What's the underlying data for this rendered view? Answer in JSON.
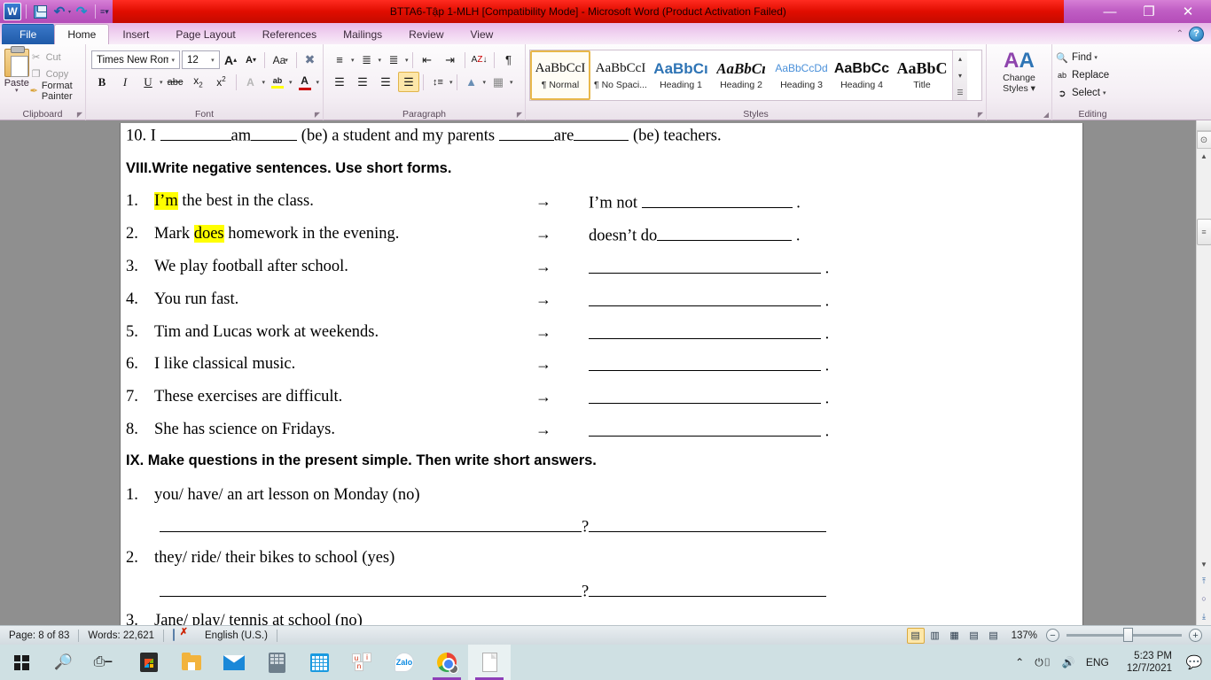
{
  "titlebar": {
    "document_title": "BTTA6-Tập 1-MLH [Compatibility Mode]  -  Microsoft Word (Product Activation Failed)",
    "qat": {
      "word_logo": "W",
      "save": "save-icon",
      "undo": "↺",
      "undo_caret": "▾",
      "redo": "↻",
      "customize": "▾"
    },
    "controls": {
      "minimize": "—",
      "restore": "❐",
      "close": "✕"
    }
  },
  "ribbon": {
    "tabs": [
      {
        "label": "File",
        "id": "file"
      },
      {
        "label": "Home",
        "id": "home"
      },
      {
        "label": "Insert",
        "id": "insert"
      },
      {
        "label": "Page Layout",
        "id": "page-layout"
      },
      {
        "label": "References",
        "id": "references"
      },
      {
        "label": "Mailings",
        "id": "mailings"
      },
      {
        "label": "Review",
        "id": "review"
      },
      {
        "label": "View",
        "id": "view"
      }
    ],
    "active_tab": "Home",
    "collapse_caret": "⌃",
    "help": "?",
    "clipboard": {
      "group_label": "Clipboard",
      "paste": "Paste",
      "paste_caret": "▾",
      "cut": "Cut",
      "copy": "Copy",
      "format_painter": "Format Painter",
      "dialog_launcher": "◤"
    },
    "font": {
      "group_label": "Font",
      "font_name": "Times New Rom",
      "font_size": "12",
      "grow_font": "A",
      "shrink_font": "A",
      "change_case": "Aa",
      "clear_formatting": "⌫",
      "bold": "B",
      "italic": "I",
      "underline": "U",
      "strikethrough": "abc",
      "subscript": "x₂",
      "superscript": "x²",
      "text_effects": "A",
      "highlight": "ab",
      "font_color": "A",
      "dialog_launcher": "◤"
    },
    "paragraph": {
      "group_label": "Paragraph",
      "bullets": "≔",
      "numbering": "≕",
      "multilevel": "≔",
      "decrease_indent": "⇤",
      "increase_indent": "⇥",
      "sort": "A↓",
      "show_marks": "¶",
      "align_left": "≡",
      "align_center": "≡",
      "align_right": "≡",
      "justify": "≡",
      "line_spacing": "↕≡",
      "shading": "▧",
      "borders": "⊞",
      "dialog_launcher": "◤"
    },
    "styles": {
      "group_label": "Styles",
      "items": [
        {
          "preview": "AaBbCcI",
          "name": "¶ Normal",
          "selected": true,
          "style": "serif-normal"
        },
        {
          "preview": "AaBbCcI",
          "name": "¶ No Spaci...",
          "selected": false,
          "style": "serif-normal"
        },
        {
          "preview": "AaBbCı",
          "name": "Heading 1",
          "selected": false,
          "style": "h1"
        },
        {
          "preview": "AaBbCı",
          "name": "Heading 2",
          "selected": false,
          "style": "h2"
        },
        {
          "preview": "AaBbCcDd",
          "name": "Heading 3",
          "selected": false,
          "style": "h3"
        },
        {
          "preview": "AaBbCc",
          "name": "Heading 4",
          "selected": false,
          "style": "h4"
        },
        {
          "preview": "AaBbC",
          "name": "Title",
          "selected": false,
          "style": "title"
        }
      ],
      "scroll_up": "▴",
      "scroll_down": "▾",
      "more": "▾",
      "dialog_launcher": "◤"
    },
    "change_styles": {
      "icon": "AA",
      "line1": "Change",
      "line2": "Styles ▾"
    },
    "editing": {
      "group_label": "Editing",
      "find": "Find",
      "find_caret": "▾",
      "replace": "Replace",
      "select": "Select",
      "select_caret": "▾"
    }
  },
  "document": {
    "q10": {
      "prefix": "10. I",
      "blank1_w": 80,
      "answer1": "am",
      "blank2_w": 50,
      "mid": "(be) a student and my parents",
      "blank3_w": 62,
      "answer2": "are",
      "blank4_w": 62,
      "suffix": "(be) teachers."
    },
    "section8_heading": "VIII.Write negative sentences. Use short forms.",
    "section8_items": [
      {
        "num": "1.",
        "pre": "",
        "hl": "I’m",
        "post": " the best in the class.",
        "arrow": "→",
        "answer_prefix": "I’m not",
        "answer_blank_w": 170,
        "period": "."
      },
      {
        "num": "2.",
        "pre": "Mark ",
        "hl": "does",
        "post": " homework in the evening.",
        "arrow": "→",
        "answer_prefix": "doesn’t do",
        "answer_blank_w": 150,
        "period": "."
      },
      {
        "num": "3.",
        "pre": "We play football after school.",
        "hl": "",
        "post": "",
        "arrow": "→",
        "answer_prefix": "",
        "answer_blank_w": 258,
        "period": "."
      },
      {
        "num": "4.",
        "pre": "You run fast.",
        "hl": "",
        "post": "",
        "arrow": "→",
        "answer_prefix": "",
        "answer_blank_w": 258,
        "period": "."
      },
      {
        "num": "5.",
        "pre": "Tim and Lucas work at weekends.",
        "hl": "",
        "post": "",
        "arrow": "→",
        "answer_prefix": "",
        "answer_blank_w": 258,
        "period": "."
      },
      {
        "num": "6.",
        "pre": "I like classical music.",
        "hl": "",
        "post": "",
        "arrow": "→",
        "answer_prefix": "",
        "answer_blank_w": 258,
        "period": "."
      },
      {
        "num": "7.",
        "pre": "These exercises are difficult.",
        "hl": "",
        "post": "",
        "arrow": "→",
        "answer_prefix": "",
        "answer_blank_w": 258,
        "period": "."
      },
      {
        "num": "8.",
        "pre": "She has science on Fridays.",
        "hl": "",
        "post": "",
        "arrow": "→",
        "answer_prefix": "",
        "answer_blank_w": 258,
        "period": "."
      }
    ],
    "section9_heading": "IX. Make questions in the present simple. Then write short answers.",
    "section9_items": [
      {
        "num": "1.",
        "prompt": "you/ have/ an art lesson on Monday (no)",
        "qmark": "?"
      },
      {
        "num": "2.",
        "prompt": "they/ ride/ their bikes to school (yes)",
        "qmark": "?"
      },
      {
        "num": "3.",
        "prompt": "Jane/ play/ tennis at school (no)",
        "qmark": "?"
      }
    ]
  },
  "scrollbar": {
    "select_browse_object": "⊙",
    "up_arrow": "▲",
    "down_arrow": "▼",
    "previous_page": "⤒",
    "browse_object": "○",
    "next_page": "⤓",
    "thumb_grip": "≡"
  },
  "statusbar": {
    "page": "Page: 8 of 83",
    "words": "Words: 22,621",
    "language": "English (U.S.)",
    "proofing_icon": "spell-check-error-icon",
    "views": [
      {
        "name": "print-layout",
        "glyph": "▤",
        "selected": true
      },
      {
        "name": "full-screen-reading",
        "glyph": "▥",
        "selected": false
      },
      {
        "name": "web-layout",
        "glyph": "▦",
        "selected": false
      },
      {
        "name": "outline",
        "glyph": "▤",
        "selected": false
      },
      {
        "name": "draft",
        "glyph": "▤",
        "selected": false
      }
    ],
    "zoom": "137%",
    "zoom_out": "−",
    "zoom_in": "+"
  },
  "taskbar": {
    "items": [
      {
        "name": "start",
        "label": "Start"
      },
      {
        "name": "search",
        "label": "Search"
      },
      {
        "name": "task-view",
        "label": "Task View"
      },
      {
        "name": "microsoft-store",
        "label": "Microsoft Store"
      },
      {
        "name": "file-explorer",
        "label": "File Explorer"
      },
      {
        "name": "mail",
        "label": "Mail"
      },
      {
        "name": "calculator",
        "label": "Calculator"
      },
      {
        "name": "calendar",
        "label": "Calendar"
      },
      {
        "name": "unikey",
        "label": "UniKey"
      },
      {
        "name": "zalo",
        "label": "Zalo"
      },
      {
        "name": "google-chrome",
        "label": "Google Chrome"
      },
      {
        "name": "microsoft-word",
        "label": "Microsoft Word"
      }
    ],
    "tray": {
      "show_hidden": "⌃",
      "battery": "battery-icon",
      "volume": "volume-icon",
      "language": "ENG",
      "time": "5:23 PM",
      "date": "12/7/2021",
      "notifications": "notification-icon"
    }
  },
  "colors": {
    "titlebar_red": "#e00d00",
    "titlebar_purple": "#c05ec4",
    "file_tab_blue": "#1f5aa8",
    "highlight_yellow": "#ffff00",
    "taskbar_bg": "#cfe0e3",
    "workspace_gray": "#8f8f8f"
  }
}
